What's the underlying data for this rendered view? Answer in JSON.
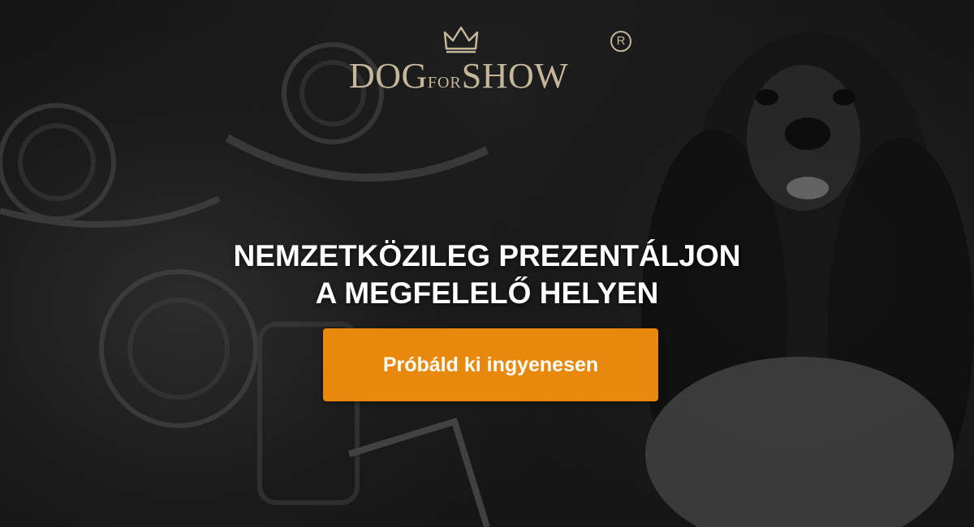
{
  "brand": {
    "logo_text_left": "DOG",
    "logo_text_mid": "FOR",
    "logo_text_right": "SHOW",
    "registered_mark": "R",
    "logo_color": "#c4b79a",
    "crown_icon": "crown-icon"
  },
  "hero": {
    "headline_line1": "NEMZETKÖZILEG PREZENTÁLJON",
    "headline_line2": "A MEGFELELŐ HELYEN",
    "cta_label": "Próbáld ki ingyenesen",
    "cta_color": "#e8890c",
    "background": "grayscale photo of show dog and trophies with rosettes"
  }
}
